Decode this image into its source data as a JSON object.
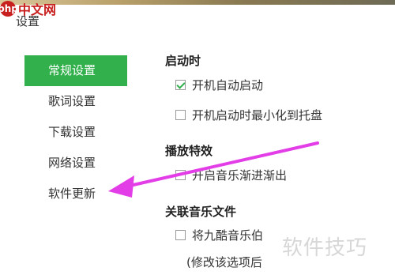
{
  "watermark_top": {
    "logo": "php",
    "text": "中文网"
  },
  "window": {
    "title": "设置"
  },
  "sidebar": {
    "items": [
      {
        "label": "常规设置",
        "active": true
      },
      {
        "label": "歌词设置",
        "active": false
      },
      {
        "label": "下载设置",
        "active": false
      },
      {
        "label": "网络设置",
        "active": false
      },
      {
        "label": "软件更新",
        "active": false
      }
    ]
  },
  "sections": {
    "startup": {
      "title": "启动时",
      "options": [
        {
          "label": "开机自动启动",
          "checked": true
        },
        {
          "label": "开机启动时最小化到托盘",
          "checked": false
        }
      ]
    },
    "playback": {
      "title": "播放特效",
      "options": [
        {
          "label": "开启音乐渐进渐出",
          "checked": false
        }
      ]
    },
    "association": {
      "title": "关联音乐文件",
      "options": [
        {
          "label": "将九酷音乐伯",
          "checked": false
        }
      ],
      "note": "(修改该选项后"
    }
  },
  "annotation": {
    "arrow_color": "#e23de6"
  },
  "watermark_bottom": "软件技巧",
  "colors": {
    "accent": "#31b04b",
    "arrow": "#e23de6"
  }
}
